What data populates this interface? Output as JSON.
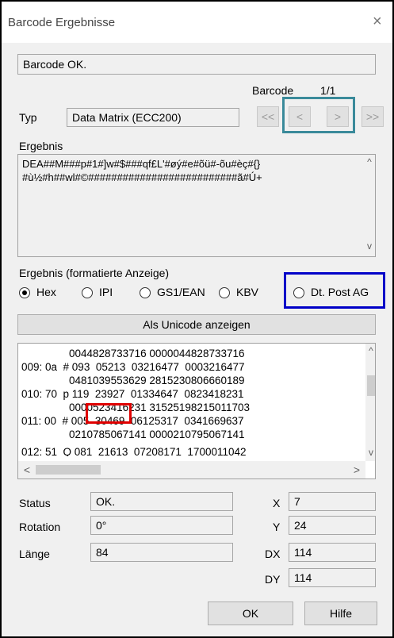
{
  "window": {
    "title": "Barcode Ergebnisse",
    "close_glyph": "×"
  },
  "status_top": "Barcode OK.",
  "barcode_nav": {
    "label": "Barcode",
    "count": "1/1",
    "first": "<<",
    "prev": "<",
    "next": ">",
    "last": ">>"
  },
  "typ": {
    "label": "Typ",
    "value": "Data Matrix (ECC200)"
  },
  "ergebnis": {
    "label": "Ergebnis",
    "line1": "DEA##M###p#1#]w#$###qf£L'#øý#e#õü#-õu#èç#{}",
    "line2": "#ù½#h##wl#©##########################ã#Ú+"
  },
  "format": {
    "label": "Ergebnis (formatierte Anzeige)",
    "options": [
      "Hex",
      "IPI",
      "GS1/EAN",
      "KBV",
      "Dt. Post AG"
    ],
    "selected": "Hex"
  },
  "unicode_button": "Als Unicode anzeigen",
  "hex_lines": [
    "                0044828733716 0000044828733716",
    "009: 0a  # 093  05213  03216477  0003216477",
    "                0481039553629 2815230806660189",
    "010: 70  p 119  23927  01334647  0823418231",
    "                0000523416231 31525198215011703",
    "011: 00  # 005  30469  06125317  0341669637",
    "                0210785067141 0000210795067141",
    "012: 51  Q 081  21613  07208171  1700011042"
  ],
  "hscroll": {
    "left": "<",
    "right": ">"
  },
  "vscroll": {
    "up": "^",
    "down": "v"
  },
  "details": {
    "status": {
      "label": "Status",
      "value": "OK."
    },
    "rotation": {
      "label": "Rotation",
      "value": "0°"
    },
    "laenge": {
      "label": "Länge",
      "value": "84"
    },
    "x": {
      "label": "X",
      "value": "7"
    },
    "y": {
      "label": "Y",
      "value": "24"
    },
    "dx": {
      "label": "DX",
      "value": "114"
    },
    "dy": {
      "label": "DY",
      "value": "114"
    }
  },
  "buttons": {
    "ok": "OK",
    "help": "Hilfe"
  },
  "annotation_colors": {
    "nav_highlight": "#3a8a9a",
    "post_highlight": "#0000c8",
    "hex_highlight": "#e00000"
  }
}
